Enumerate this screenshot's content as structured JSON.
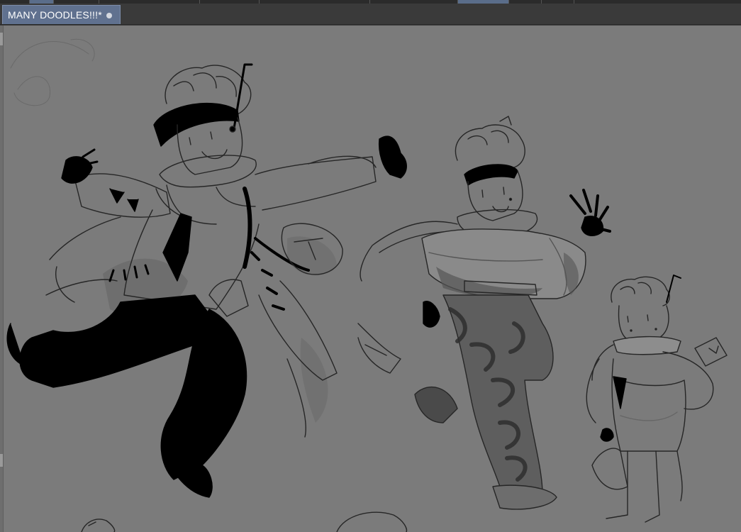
{
  "document_tab": {
    "title": "MANY DOODLES!!!*",
    "modified_indicator": "unsaved-dot-icon"
  },
  "canvas": {
    "background_color": "#7b7b7b",
    "content": "grayscale character sketches"
  },
  "colors": {
    "tab_active": "#60718f",
    "chrome": "#3a3a3a",
    "canvas": "#7b7b7b",
    "ink": "#000000"
  }
}
